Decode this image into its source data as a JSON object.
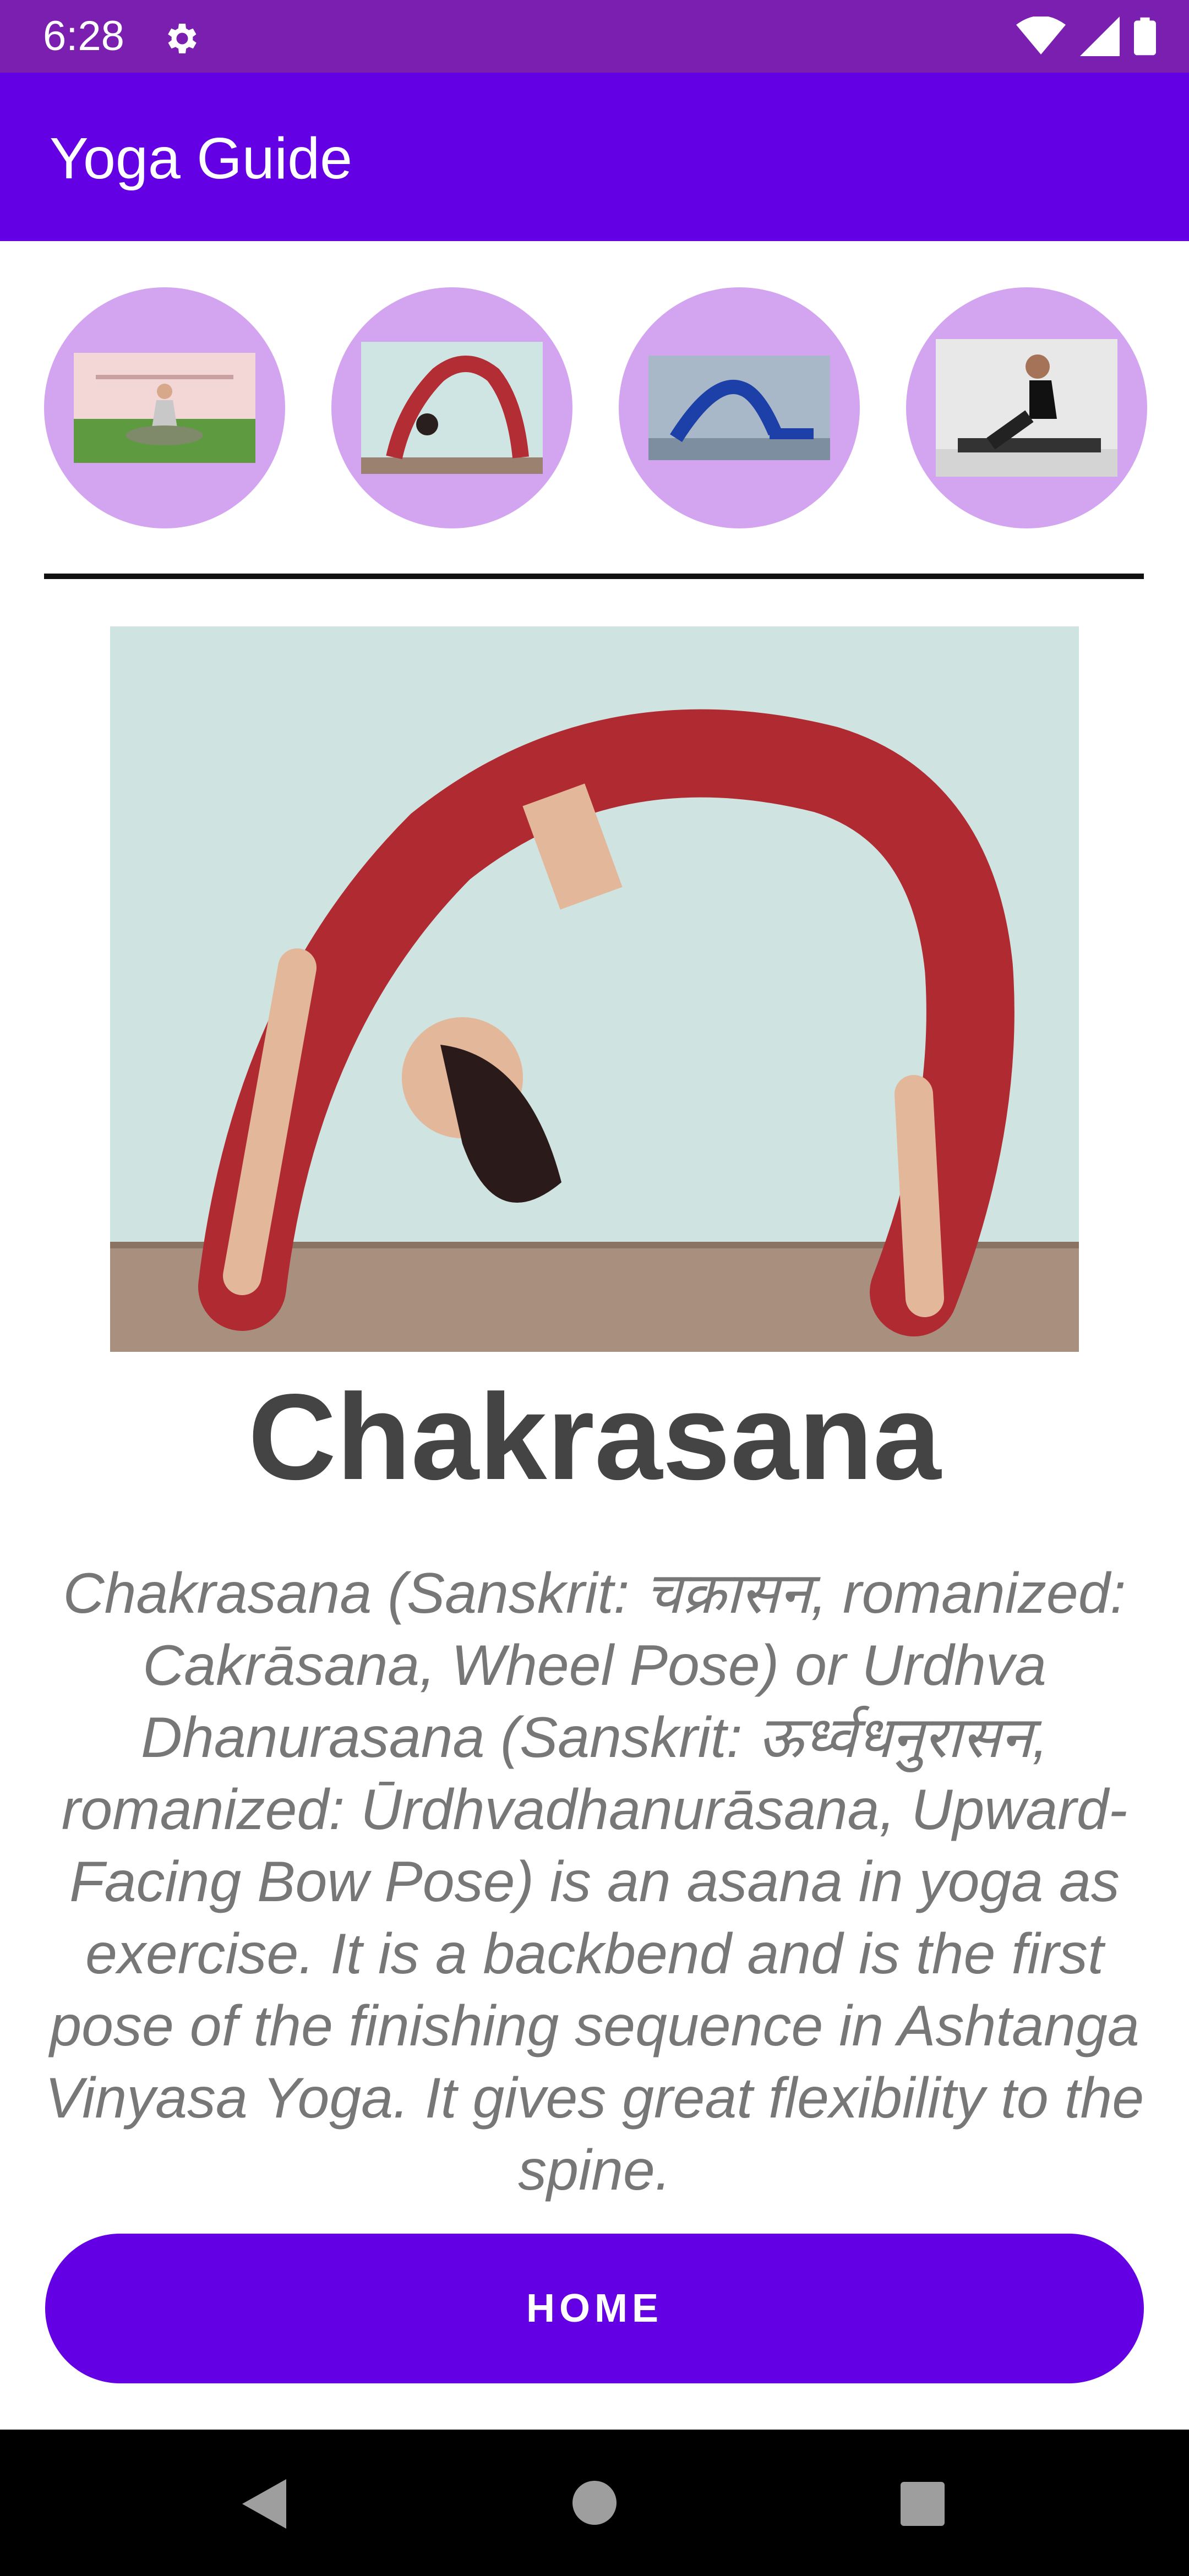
{
  "status_bar": {
    "time": "6:28",
    "icons": [
      "gear-icon",
      "wifi-icon",
      "signal-icon",
      "battery-icon"
    ]
  },
  "app_bar": {
    "title": "Yoga Guide"
  },
  "thumbnails": [
    {
      "name": "seated-meditation-pose"
    },
    {
      "name": "wheel-pose"
    },
    {
      "name": "plough-pose"
    },
    {
      "name": "cobra-pose"
    }
  ],
  "detail": {
    "title": "Chakrasana",
    "description": "Chakrasana (Sanskrit: चक्रासन, romanized: Cakrāsana, Wheel Pose) or Urdhva Dhanurasana (Sanskrit: ऊर्ध्वधनुरासन, romanized: Ūrdhvadhanurāsana, Upward-Facing Bow Pose) is an asana in yoga as exercise. It is a backbend and is the first pose of the finishing sequence in Ashtanga Vinyasa Yoga. It gives great flexibility to the spine."
  },
  "home_button": {
    "label": "HOME"
  },
  "nav_bar": {
    "icons": [
      "back-icon",
      "home-circle-icon",
      "recents-icon"
    ]
  },
  "colors": {
    "status_bar": "#7a1fb0",
    "app_bar": "#6400e4",
    "thumbnail_circle": "#d3a5f0",
    "button": "#6400e4",
    "title_text": "#444444",
    "description_text": "#777777"
  }
}
